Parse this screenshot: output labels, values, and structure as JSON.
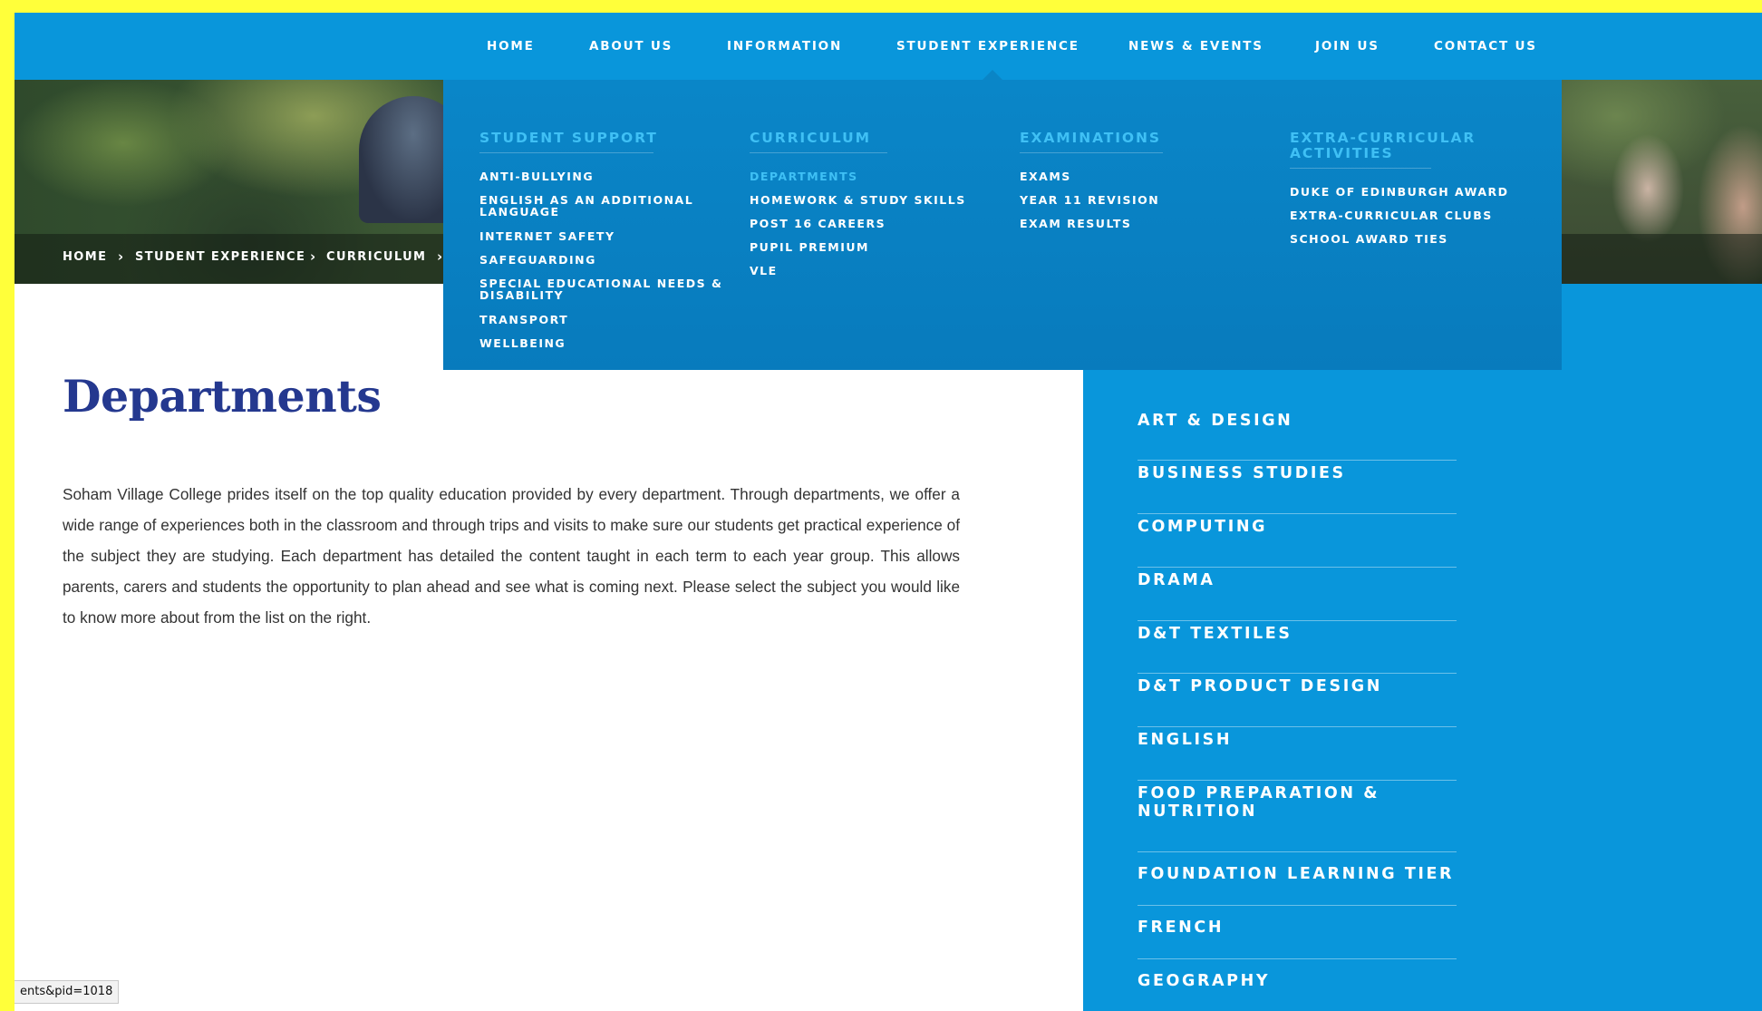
{
  "nav": {
    "items": [
      {
        "label": "HOME"
      },
      {
        "label": "ABOUT US"
      },
      {
        "label": "INFORMATION"
      },
      {
        "label": "STUDENT EXPERIENCE"
      },
      {
        "label": "NEWS & EVENTS"
      },
      {
        "label": "JOIN US"
      },
      {
        "label": "CONTACT US"
      }
    ]
  },
  "breadcrumb": {
    "items": [
      "HOME",
      "STUDENT EXPERIENCE",
      "CURRICULUM"
    ],
    "separator": "›"
  },
  "dropdown": {
    "columns": [
      {
        "heading": "STUDENT SUPPORT",
        "links": [
          "ANTI-BULLYING",
          "ENGLISH AS AN ADDITIONAL",
          "LANGUAGE",
          "INTERNET SAFETY",
          "SAFEGUARDING",
          "SPECIAL EDUCATIONAL NEEDS &",
          "DISABILITY",
          "TRANSPORT",
          "WELLBEING"
        ]
      },
      {
        "heading": "CURRICULUM",
        "links": [
          "DEPARTMENTS",
          "HOMEWORK & STUDY SKILLS",
          "POST 16 CAREERS",
          "PUPIL PREMIUM",
          "VLE"
        ]
      },
      {
        "heading": "EXAMINATIONS",
        "links": [
          "EXAMS",
          "YEAR 11 REVISION",
          "EXAM RESULTS"
        ]
      },
      {
        "heading": [
          "EXTRA-CURRICULAR",
          "ACTIVITIES"
        ],
        "links": [
          "DUKE OF EDINBURGH AWARD",
          "EXTRA-CURRICULAR CLUBS",
          "SCHOOL AWARD TIES"
        ]
      }
    ]
  },
  "main": {
    "title": "Departments",
    "body": "Soham Village College prides itself on the top quality education provided by every department.  Through departments, we offer a wide range of experiences both in the classroom and through trips and visits to make sure our students get practical experience of the subject they are studying.  Each department has detailed the content taught in each term to each year group.  This allows parents, carers and students the opportunity to plan ahead and see what is coming next.  Please select the subject you would like to know more about from the list on the right."
  },
  "sidebar": {
    "items": [
      "ART & DESIGN",
      "BUSINESS STUDIES",
      "COMPUTING",
      "DRAMA",
      "D&T TEXTILES",
      "D&T PRODUCT DESIGN",
      "ENGLISH",
      [
        "FOOD PREPARATION &",
        "NUTRITION"
      ],
      "FOUNDATION LEARNING TIER",
      "FRENCH",
      "GEOGRAPHY"
    ]
  },
  "status": {
    "url_fragment": "ents&pid=1018"
  },
  "colors": {
    "nav_bg": "#0996db",
    "dropdown_bg": "#0a86c8",
    "accent": "#3fc0f5",
    "title": "#24388f",
    "frame_border": "#ffff3a"
  }
}
